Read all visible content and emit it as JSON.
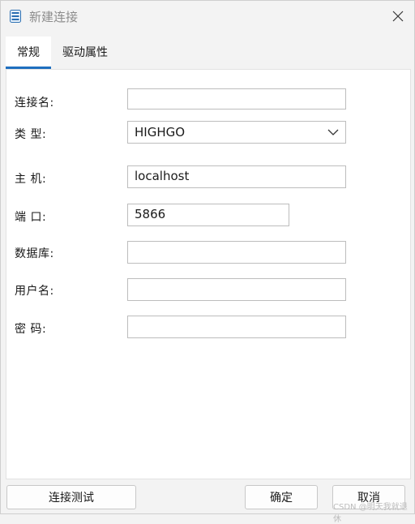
{
  "window": {
    "title": "新建连接"
  },
  "tabs": [
    {
      "label": "常规",
      "active": true
    },
    {
      "label": "驱动属性",
      "active": false
    }
  ],
  "form": {
    "conn_name_label": "连接名:",
    "conn_name_value": "",
    "type_label": "类 型:",
    "type_value": "HIGHGO",
    "host_label": "主 机:",
    "host_value": "localhost",
    "port_label": "端 口:",
    "port_value": "5866",
    "db_label": "数据库:",
    "db_value": "",
    "user_label": "用户名:",
    "user_value": "",
    "pwd_label": "密 码:",
    "pwd_value": ""
  },
  "buttons": {
    "test": "连接测试",
    "ok": "确定",
    "cancel": "取消"
  },
  "watermark": "CSDN @明天我就退休",
  "colors": {
    "accent": "#1f6fbf",
    "panel": "#ffffff",
    "window": "#f3f3f3"
  }
}
